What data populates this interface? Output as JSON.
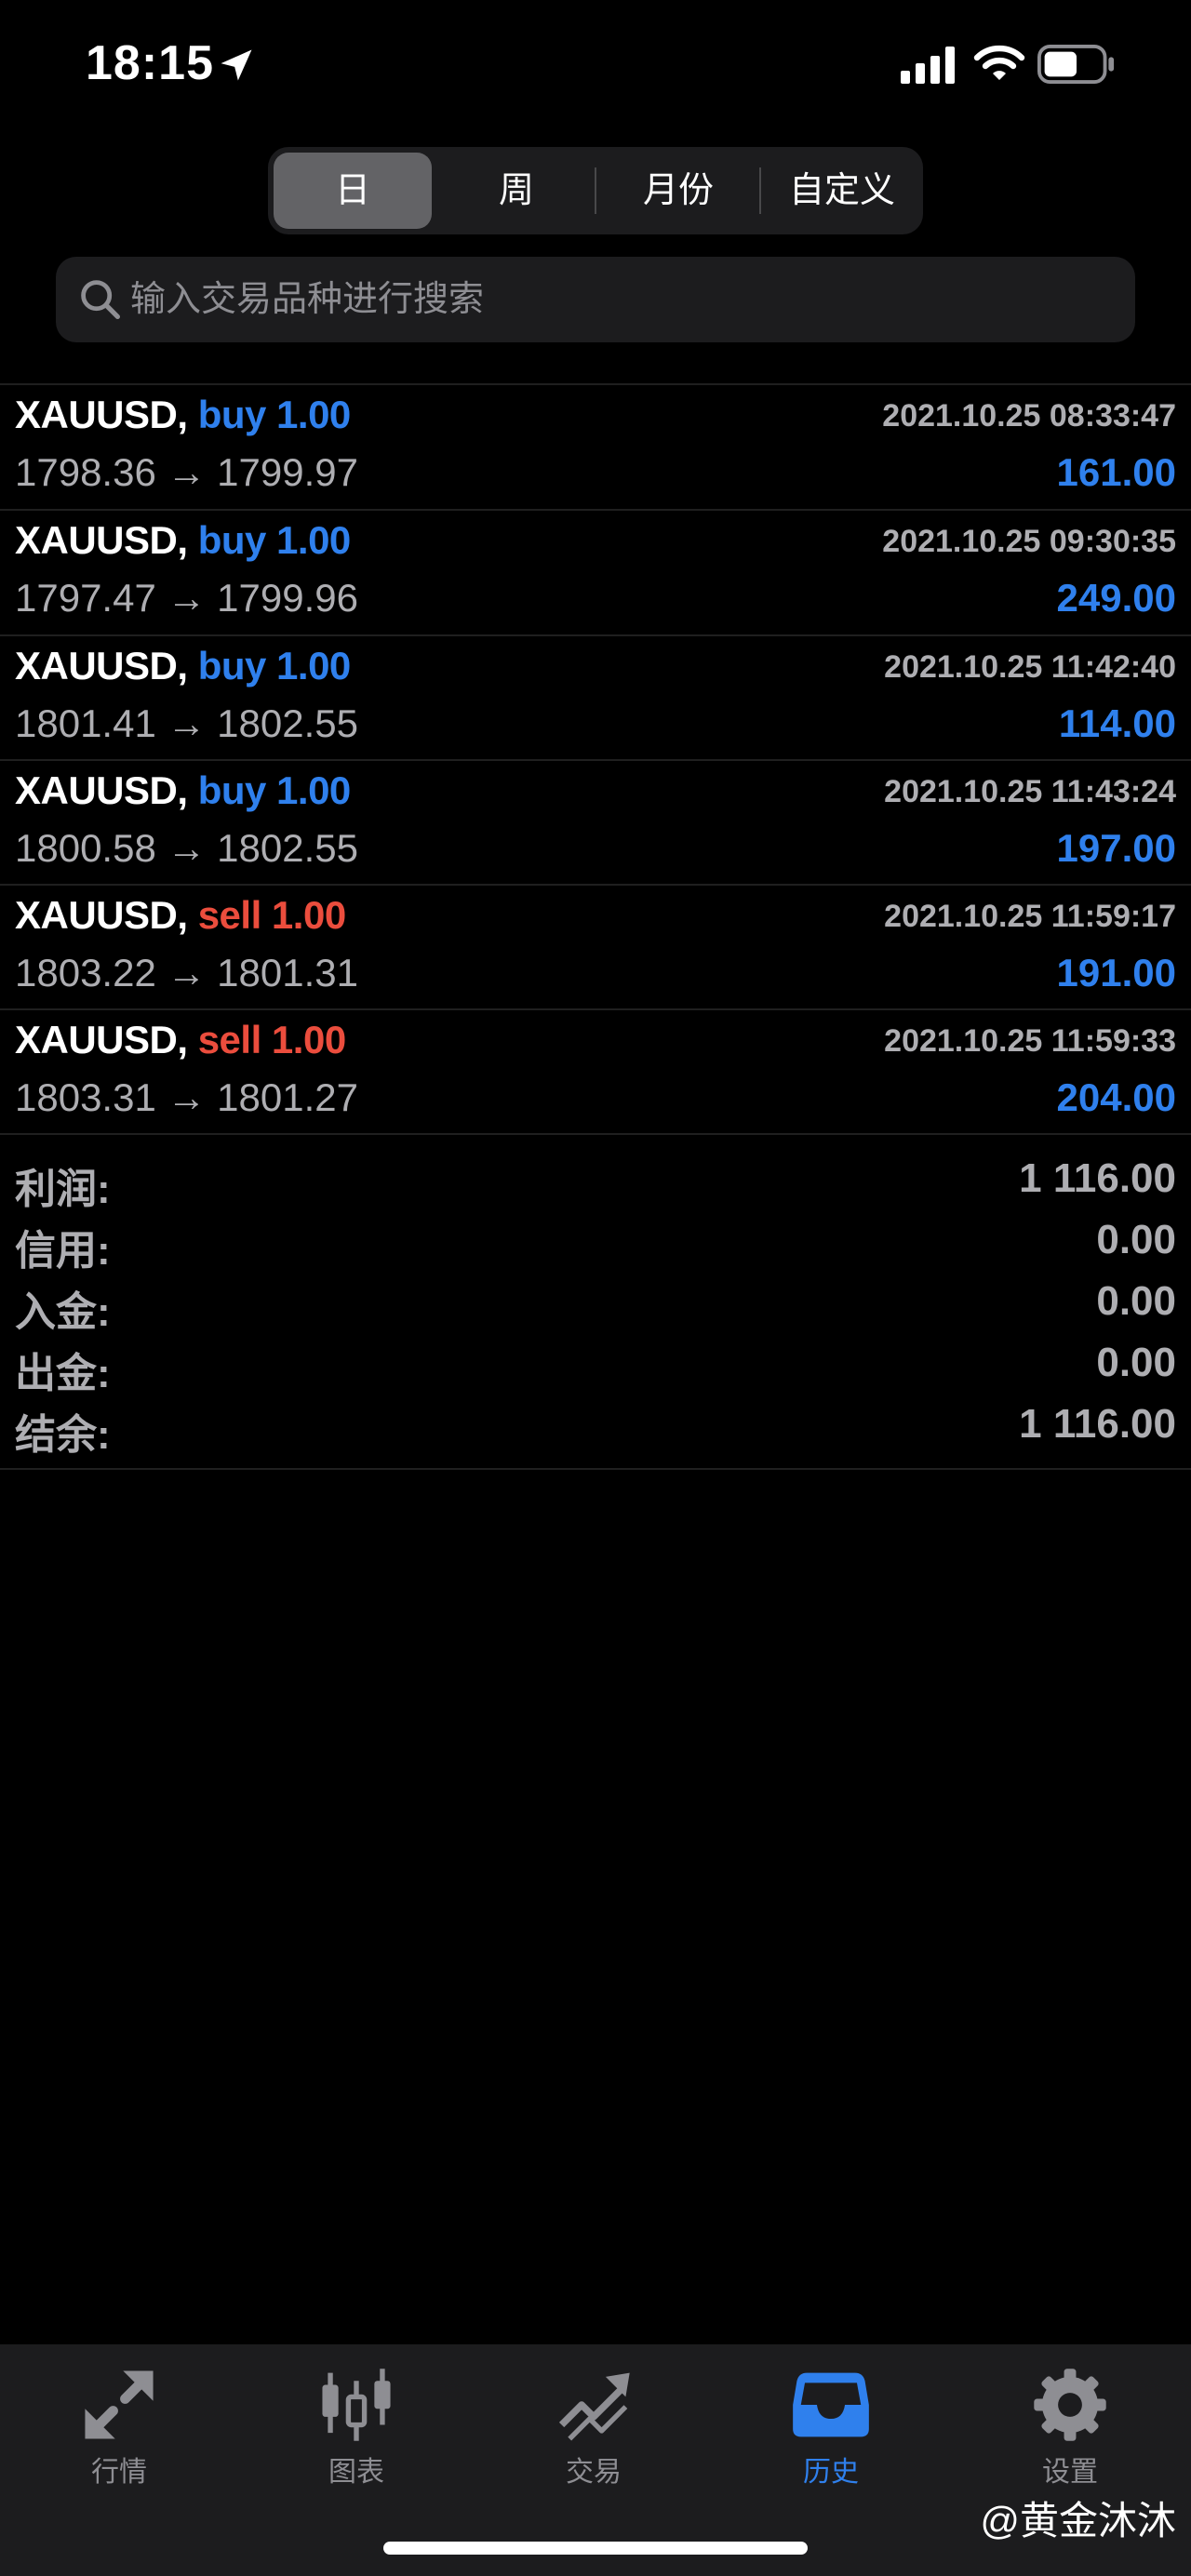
{
  "status_bar": {
    "time": "18:15"
  },
  "segments": [
    {
      "label": "日",
      "active": true
    },
    {
      "label": "周",
      "active": false
    },
    {
      "label": "月份",
      "active": false
    },
    {
      "label": "自定义",
      "active": false
    }
  ],
  "search": {
    "placeholder": "输入交易品种进行搜索"
  },
  "deals": [
    {
      "symbol": "XAUUSD,",
      "direction": "buy 1.00",
      "datetime": "2021.10.25 08:33:47",
      "prices": "1798.36 → 1799.97",
      "profit": "161.00"
    },
    {
      "symbol": "XAUUSD,",
      "direction": "buy 1.00",
      "datetime": "2021.10.25 09:30:35",
      "prices": "1797.47 → 1799.96",
      "profit": "249.00"
    },
    {
      "symbol": "XAUUSD,",
      "direction": "buy 1.00",
      "datetime": "2021.10.25 11:42:40",
      "prices": "1801.41 → 1802.55",
      "profit": "114.00"
    },
    {
      "symbol": "XAUUSD,",
      "direction": "buy 1.00",
      "datetime": "2021.10.25 11:43:24",
      "prices": "1800.58 → 1802.55",
      "profit": "197.00"
    },
    {
      "symbol": "XAUUSD,",
      "direction": "sell 1.00",
      "datetime": "2021.10.25 11:59:17",
      "prices": "1803.22 → 1801.31",
      "profit": "191.00"
    },
    {
      "symbol": "XAUUSD,",
      "direction": "sell 1.00",
      "datetime": "2021.10.25 11:59:33",
      "prices": "1803.31 → 1801.27",
      "profit": "204.00"
    }
  ],
  "summary": [
    {
      "label": "利润:",
      "value": "1 116.00"
    },
    {
      "label": "信用:",
      "value": "0.00"
    },
    {
      "label": "入金:",
      "value": "0.00"
    },
    {
      "label": "出金:",
      "value": "0.00"
    },
    {
      "label": "结余:",
      "value": "1 116.00"
    }
  ],
  "tabs": [
    {
      "label": "行情",
      "icon": "quotes-arrows-icon",
      "active": false
    },
    {
      "label": "图表",
      "icon": "candlestick-chart-icon",
      "active": false
    },
    {
      "label": "交易",
      "icon": "trade-trend-icon",
      "active": false
    },
    {
      "label": "历史",
      "icon": "history-tray-icon",
      "active": true
    },
    {
      "label": "设置",
      "icon": "gear-icon",
      "active": false
    }
  ],
  "watermark": "@黄金沐沐",
  "colors": {
    "accent": "#2f80ed",
    "sell": "#eb4d3d",
    "background": "#000000",
    "muted": "#aeaeb2"
  }
}
